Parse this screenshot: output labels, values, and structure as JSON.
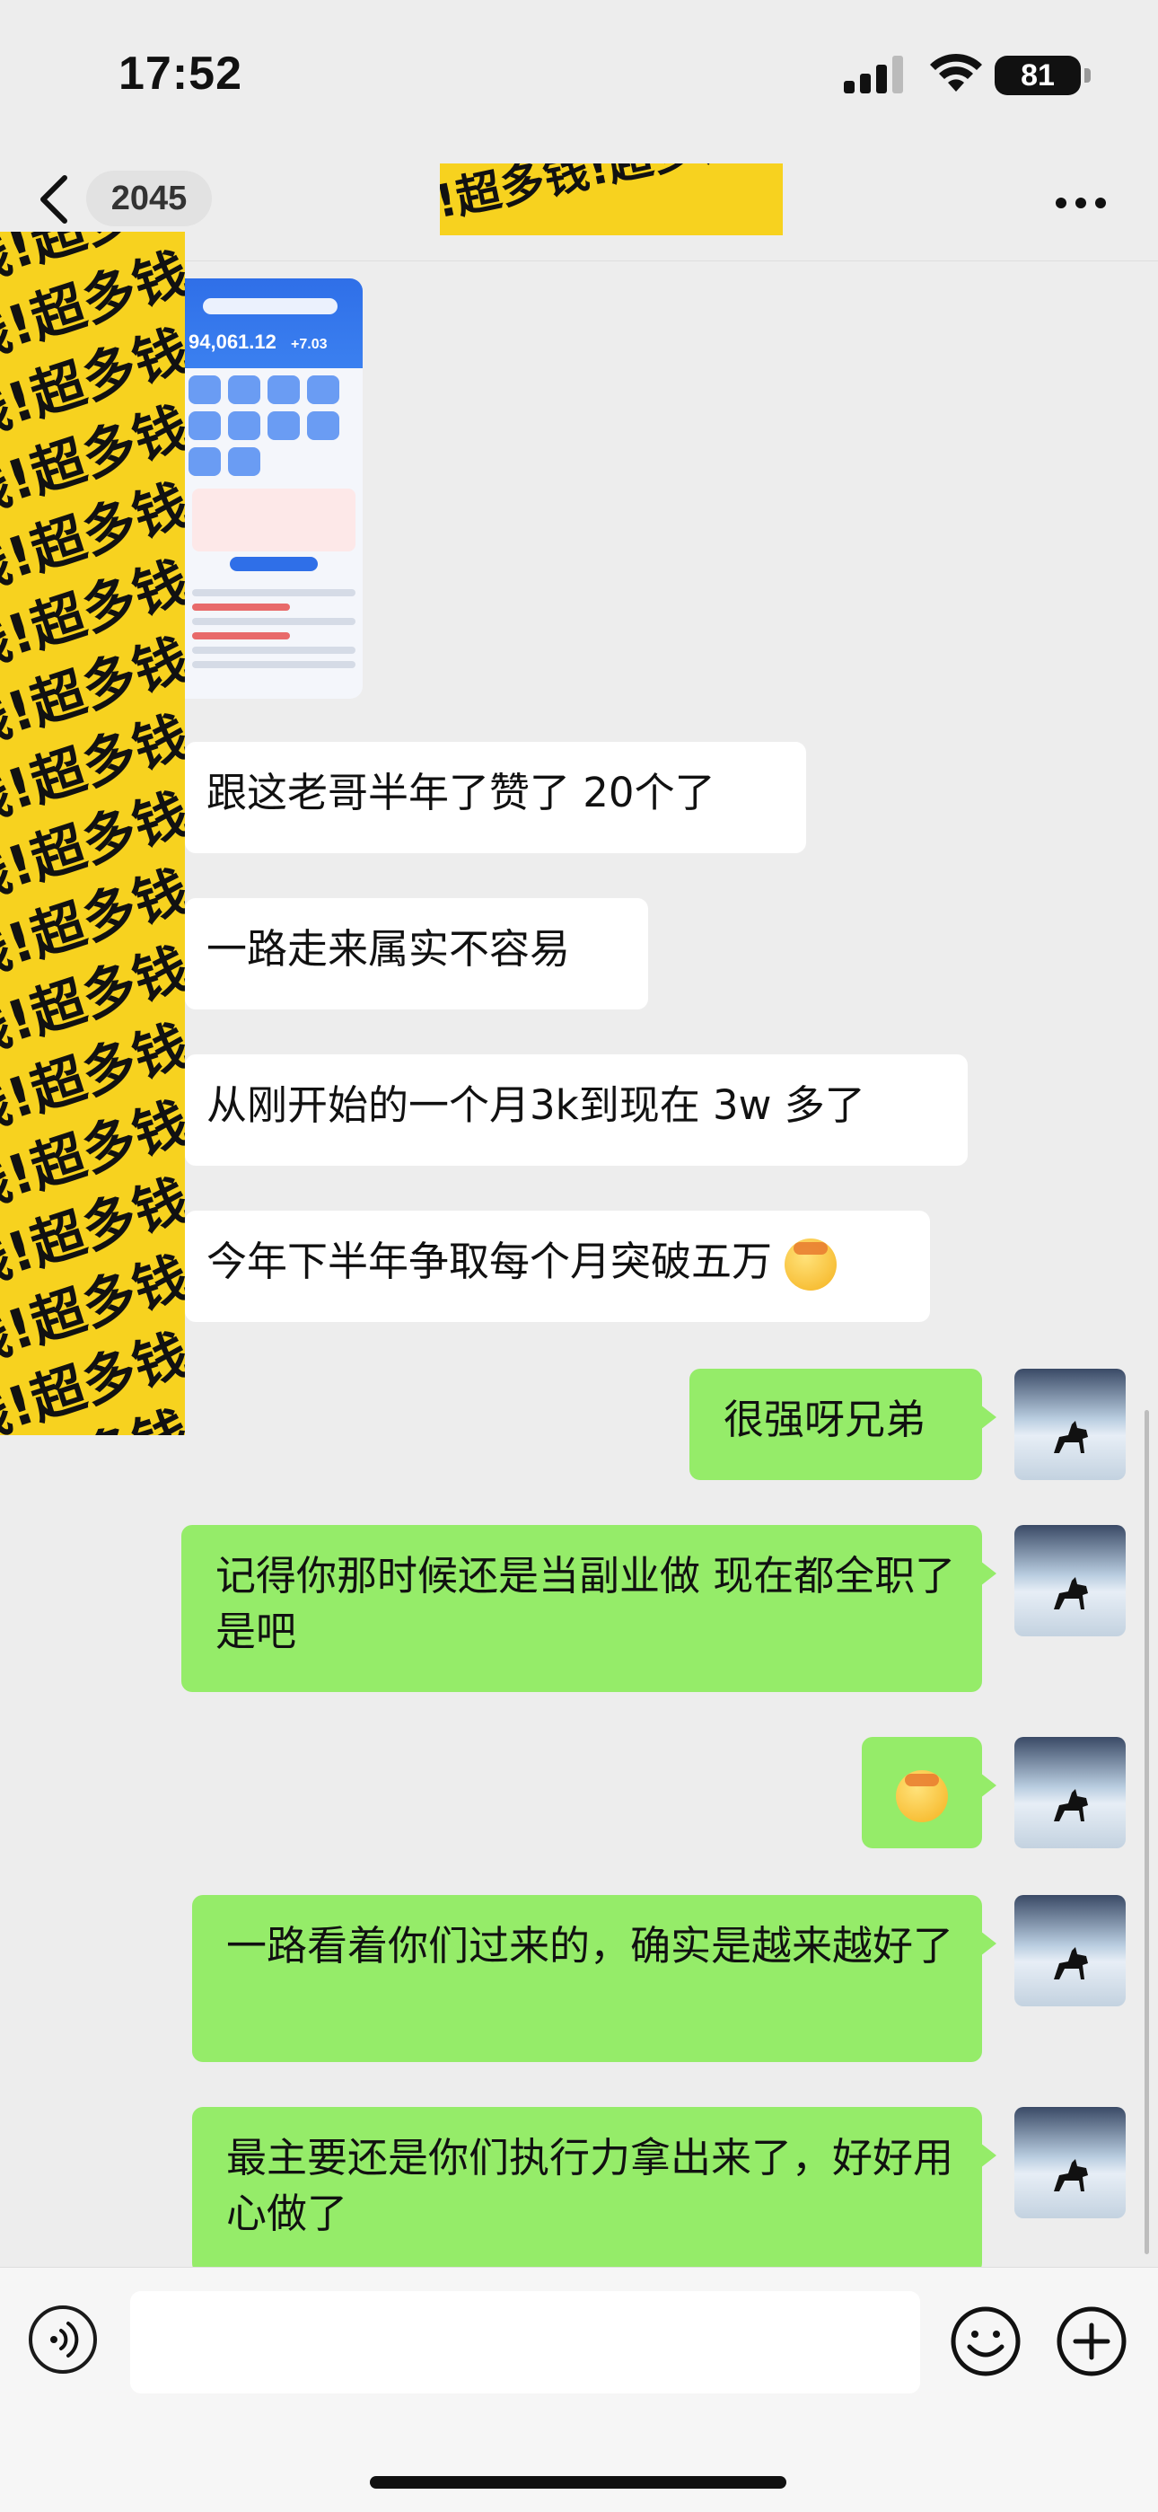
{
  "status_bar": {
    "time": "17:52",
    "battery": "81"
  },
  "nav": {
    "unread_count": "2045"
  },
  "redaction": {
    "pattern": "钱!超多钱!超多钱!超多钱!超多"
  },
  "messages": [
    {
      "side": "in",
      "text": "跟这老哥半年了赞了 20个了"
    },
    {
      "side": "in",
      "text": "一路走来属实不容易"
    },
    {
      "side": "in",
      "text": "从刚开始的一个月3k到现在 3w 多了"
    },
    {
      "side": "in",
      "text": "今年下半年争取每个月突破五万"
    },
    {
      "side": "out",
      "text": "很强呀兄弟"
    },
    {
      "side": "out",
      "text": "记得你那时候还是当副业做 现在都全职了是吧"
    },
    {
      "side": "out",
      "text": ""
    },
    {
      "side": "out",
      "text": "一路看着你们过来的，确实是越来越好了"
    },
    {
      "side": "out",
      "text": "最主要还是你们执行力拿出来了，好好用心做了"
    }
  ],
  "shared_image": {
    "amount": "94,061.12",
    "change": "+7.03"
  },
  "colors": {
    "incoming": "#ffffff",
    "outgoing": "#95ec69",
    "background": "#ededed",
    "redaction": "#f7d21f"
  },
  "icons": [
    "back-icon",
    "more-icon",
    "voice-icon",
    "emoji-icon",
    "plus-icon",
    "signal-icon",
    "wifi-icon"
  ]
}
